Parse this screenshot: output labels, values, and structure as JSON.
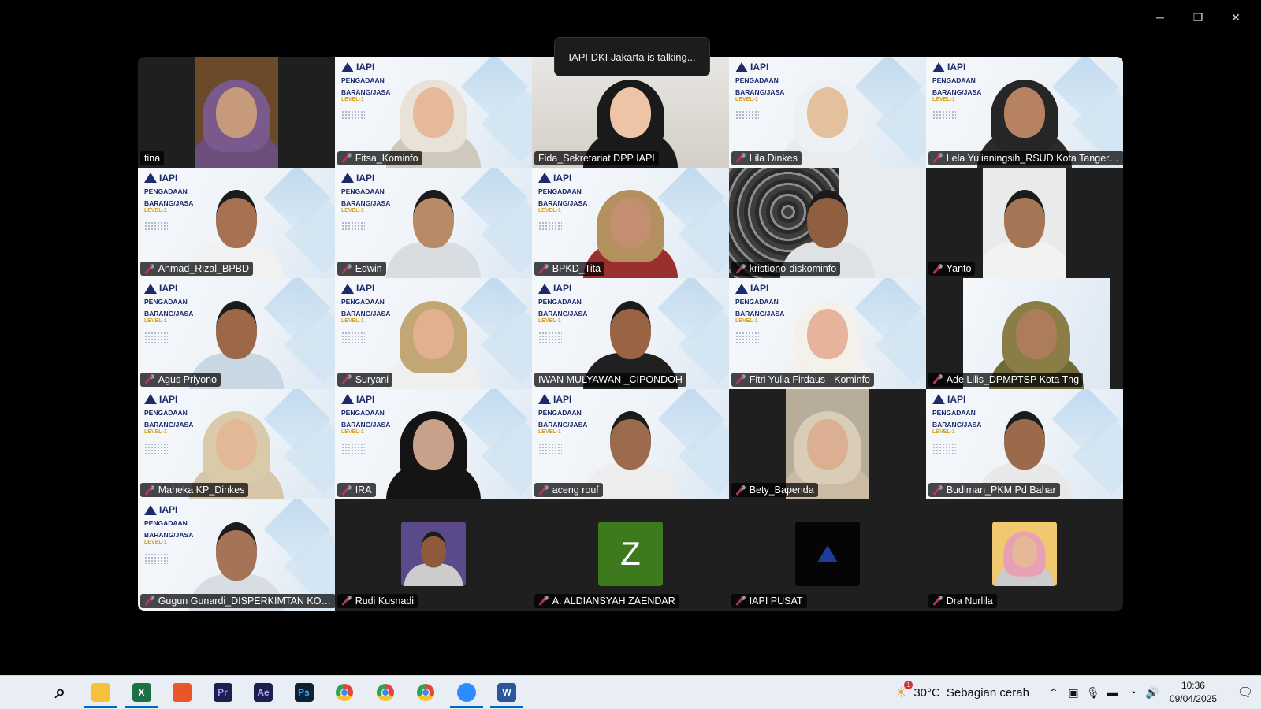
{
  "toast": "IAPI DKI Jakarta is talking...",
  "window_controls": {
    "minimize": "─",
    "restore": "❐",
    "close": "✕"
  },
  "slide": {
    "logo": "IAPI",
    "line1": "PENGADAAN",
    "line2": "BARANG/JASA",
    "level": "LEVEL-1"
  },
  "participants": [
    {
      "name": "tina",
      "muted": false,
      "bg": "dark",
      "skin": "#c79a7a",
      "cloth": "#6b4e7a",
      "hijab": "#7a5a8c",
      "room": "#6b4a2a"
    },
    {
      "name": "Fitsa_Kominfo",
      "muted": true,
      "bg": "slide",
      "skin": "#e6b99a",
      "cloth": "#cfc8bd",
      "hijab": "#e9e2d8"
    },
    {
      "name": "Fida_Sekretariat DPP IAPI",
      "muted": false,
      "bg": "room",
      "skin": "#edc4a6",
      "cloth": "#1a1a1a",
      "hijab": "#1a1a1a"
    },
    {
      "name": "Lila Dinkes",
      "muted": true,
      "bg": "slide",
      "skin": "#e4c09c",
      "cloth": "#e9ecef",
      "hijab": "#eef1f3"
    },
    {
      "name": "Lela Yulianingsih_RSUD Kota Tangerang",
      "muted": true,
      "bg": "slide",
      "skin": "#b78262",
      "cloth": "#2b2b2b",
      "hijab": "#262626"
    },
    {
      "name": "Ahmad_Rizal_BPBD",
      "muted": true,
      "bg": "slide",
      "skin": "#a77252",
      "cloth": "#f1f1f1"
    },
    {
      "name": "Edwin",
      "muted": true,
      "bg": "slide",
      "skin": "#b88a66",
      "cloth": "#d8dde2"
    },
    {
      "name": "BPKD_Tita",
      "muted": true,
      "bg": "slide",
      "skin": "#c48e70",
      "cloth": "#9a2f2f",
      "hijab": "#b5905f"
    },
    {
      "name": "kristiono-diskominfo",
      "muted": true,
      "bg": "pattern",
      "skin": "#8f5f3f",
      "cloth": "#dfe2e5"
    },
    {
      "name": "Yanto",
      "muted": true,
      "bg": "dark-inset",
      "skin": "#a57656",
      "cloth": "#f2f2f2",
      "room": "#e9eaea"
    },
    {
      "name": "Agus Priyono",
      "muted": true,
      "bg": "slide",
      "skin": "#9c6848",
      "cloth": "#c9d6e3"
    },
    {
      "name": "Suryani",
      "muted": true,
      "bg": "slide",
      "skin": "#e1b08e",
      "cloth": "#efefef",
      "hijab": "#c2a676"
    },
    {
      "name": "IWAN MULYAWAN _CIPONDOH",
      "muted": false,
      "bg": "slide",
      "skin": "#9a6444",
      "cloth": "#202020"
    },
    {
      "name": "Fitri Yulia Firdaus - Kominfo",
      "muted": true,
      "bg": "slide",
      "skin": "#e6b49a",
      "cloth": "#f2f2f2",
      "hijab": "#f4f0ea"
    },
    {
      "name": "Ade Lilis_DPMPTSP Kota Tng",
      "muted": true,
      "bg": "dark-slide",
      "skin": "#ad7c5a",
      "cloth": "#6e6a3a",
      "hijab": "#8a7d45"
    },
    {
      "name": "Maheka KP_Dinkes",
      "muted": true,
      "bg": "slide",
      "skin": "#e2b896",
      "cloth": "#d6c5a8",
      "hijab": "#d9caa9"
    },
    {
      "name": "IRA",
      "muted": true,
      "bg": "slide",
      "skin": "#c9a08a",
      "cloth": "#141414",
      "hijab": "#141414"
    },
    {
      "name": "aceng rouf",
      "muted": true,
      "bg": "slide",
      "skin": "#9c6a4c",
      "cloth": "#ededed"
    },
    {
      "name": "Bety_Bapenda",
      "muted": true,
      "bg": "dark-inset",
      "skin": "#dcae92",
      "cloth": "#cbbba5",
      "hijab": "#d9cdb8",
      "room": "#b7ad9a"
    },
    {
      "name": "Budiman_PKM Pd Bahar",
      "muted": true,
      "bg": "slide",
      "skin": "#9a6a4a",
      "cloth": "#e8e8e8"
    },
    {
      "name": "Gugun Gunardi_DISPERKIMTAN KOTA TANGERANG",
      "muted": true,
      "bg": "slide",
      "skin": "#a57355",
      "cloth": "#d7dde3"
    },
    {
      "name": "Rudi Kusnadi",
      "muted": true,
      "bg": "avatar-photo",
      "avatar_bg": "#5a4a8a",
      "skin": "#8d5a3c"
    },
    {
      "name": "A. ALDIANSYAH ZAENDAR",
      "muted": true,
      "bg": "avatar-letter",
      "letter": "Z",
      "avatar_bg": "#3d7a1e"
    },
    {
      "name": "IAPI PUSAT",
      "muted": true,
      "bg": "avatar-logo",
      "avatar_bg": "#050505"
    },
    {
      "name": "Dra Nurlila",
      "muted": true,
      "bg": "avatar-photo",
      "avatar_bg": "#f0c870",
      "skin": "#e6b898",
      "hijab": "#e8a0b4"
    }
  ],
  "taskbar": {
    "apps": [
      {
        "icon": "windows-start-icon",
        "label": "",
        "color": "#0067c0",
        "text": ""
      },
      {
        "icon": "search-icon",
        "label": "",
        "color": "",
        "text": ""
      },
      {
        "icon": "file-explorer-icon",
        "label": "",
        "color": "#f3c13a",
        "text": ""
      },
      {
        "icon": "excel-icon",
        "label": "",
        "color": "#1d7044",
        "text": "X"
      },
      {
        "icon": "powerpoint-icon",
        "label": "",
        "color": "#e8562a",
        "text": ""
      },
      {
        "icon": "premiere-pro-icon",
        "label": "",
        "color": "#1d1f4e",
        "text": "Pr"
      },
      {
        "icon": "after-effects-icon",
        "label": "",
        "color": "#1d1f4e",
        "text": "Ae"
      },
      {
        "icon": "photoshop-icon",
        "label": "",
        "color": "#0d2235",
        "text": "Ps"
      },
      {
        "icon": "chrome-icon",
        "label": "",
        "color": "#e5443a",
        "text": ""
      },
      {
        "icon": "chrome-profile-w-icon",
        "label": "",
        "color": "#e5443a",
        "text": ""
      },
      {
        "icon": "chrome-profile-i-icon",
        "label": "",
        "color": "#e5443a",
        "text": ""
      },
      {
        "icon": "zoom-icon",
        "label": "",
        "color": "#2d8cff",
        "text": ""
      },
      {
        "icon": "word-icon",
        "label": "",
        "color": "#2b579a",
        "text": "W"
      }
    ],
    "active": [
      2,
      3,
      11,
      12
    ],
    "weather": {
      "temp": "30°C",
      "desc": "Sebagian cerah",
      "badge": "1"
    },
    "clock": {
      "time": "10:36",
      "date": "09/04/2025"
    }
  }
}
